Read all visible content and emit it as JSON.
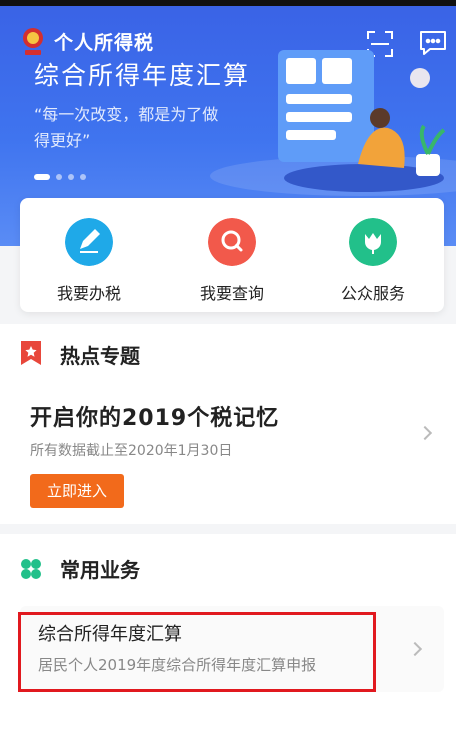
{
  "header": {
    "title": "个人所得税"
  },
  "banner": {
    "headline": "综合所得年度汇算",
    "subtitle": "“每一次改变，都是为了做得更好”",
    "carousel_total": 4,
    "carousel_active": 1
  },
  "quick_actions": [
    {
      "label": "我要办税",
      "icon": "pencil-icon",
      "color": "#1fa9e8"
    },
    {
      "label": "我要查询",
      "icon": "search-icon",
      "color": "#f2594b"
    },
    {
      "label": "公众服务",
      "icon": "tulip-icon",
      "color": "#22c08a"
    }
  ],
  "hot_topics": {
    "section_title": "热点专题",
    "card_title": "开启你的2019个税记忆",
    "card_subtitle": "所有数据截止至2020年1月30日",
    "cta_label": "立即进入"
  },
  "common_services": {
    "section_title": "常用业务",
    "item_title": "综合所得年度汇算",
    "item_subtitle": "居民个人2019年度综合所得年度汇算申报"
  },
  "colors": {
    "brand_blue": "#3f74ef",
    "cta_orange": "#f26a1b",
    "highlight_red": "#e1191f"
  }
}
